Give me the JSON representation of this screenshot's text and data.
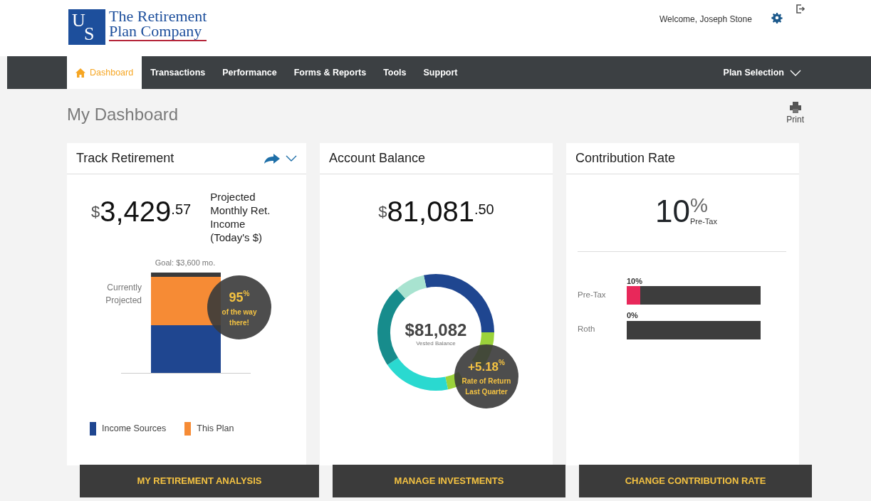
{
  "logo": {
    "letters": [
      "U",
      "S"
    ],
    "name_lines": [
      "The Retirement",
      "Plan Company"
    ]
  },
  "user": {
    "welcome": "Welcome,  Joseph Stone"
  },
  "nav": {
    "items": [
      {
        "label": "Dashboard",
        "selected": true,
        "kind": "home"
      },
      {
        "label": "Transactions",
        "selected": false
      },
      {
        "label": "Performance",
        "selected": false
      },
      {
        "label": "Forms & Reports",
        "selected": false
      },
      {
        "label": "Tools",
        "selected": false
      },
      {
        "label": "Support",
        "selected": false
      }
    ],
    "plan_selection": "Plan Selection"
  },
  "page": {
    "title": "My Dashboard",
    "print": "Print"
  },
  "cards": [
    {
      "kind": "retirement",
      "title": "Track Retirement",
      "currency": "$",
      "amount": "3,429",
      "cents": ".57",
      "caption": [
        "Projected",
        "Monthly Ret.",
        "Income",
        "(Today's $)"
      ],
      "goal": "Goal: $3,600 mo.",
      "projected_label": [
        "Currently",
        "Projected"
      ],
      "badge": {
        "value": "95",
        "unit": "%",
        "lines": [
          "of the way",
          "there!"
        ]
      },
      "legend": [
        {
          "label": "Income Sources",
          "color": "#1f4690"
        },
        {
          "label": "This Plan",
          "color": "#f68b35"
        }
      ],
      "action": "MY RETIREMENT ANALYSIS"
    },
    {
      "kind": "balance",
      "title": "Account Balance",
      "currency": "$",
      "amount": "81,081",
      "cents": ".50",
      "center_value": "$81,082",
      "center_label": "Vested Balance",
      "badge": {
        "value": "+5.18",
        "unit": "%",
        "lines": [
          "Rate of Return",
          "Last Quarter"
        ]
      },
      "action": "MANAGE INVESTMENTS"
    },
    {
      "kind": "contribution",
      "title": "Contribution Rate",
      "rate": "10",
      "unit": "%",
      "rate_label": "Pre-Tax",
      "bars": [
        {
          "label": "Pre-Tax",
          "value": "10%",
          "level": 0.1
        },
        {
          "label": "Roth",
          "value": "0%",
          "level": 0
        }
      ],
      "action": "CHANGE CONTRIBUTION RATE"
    }
  ]
}
